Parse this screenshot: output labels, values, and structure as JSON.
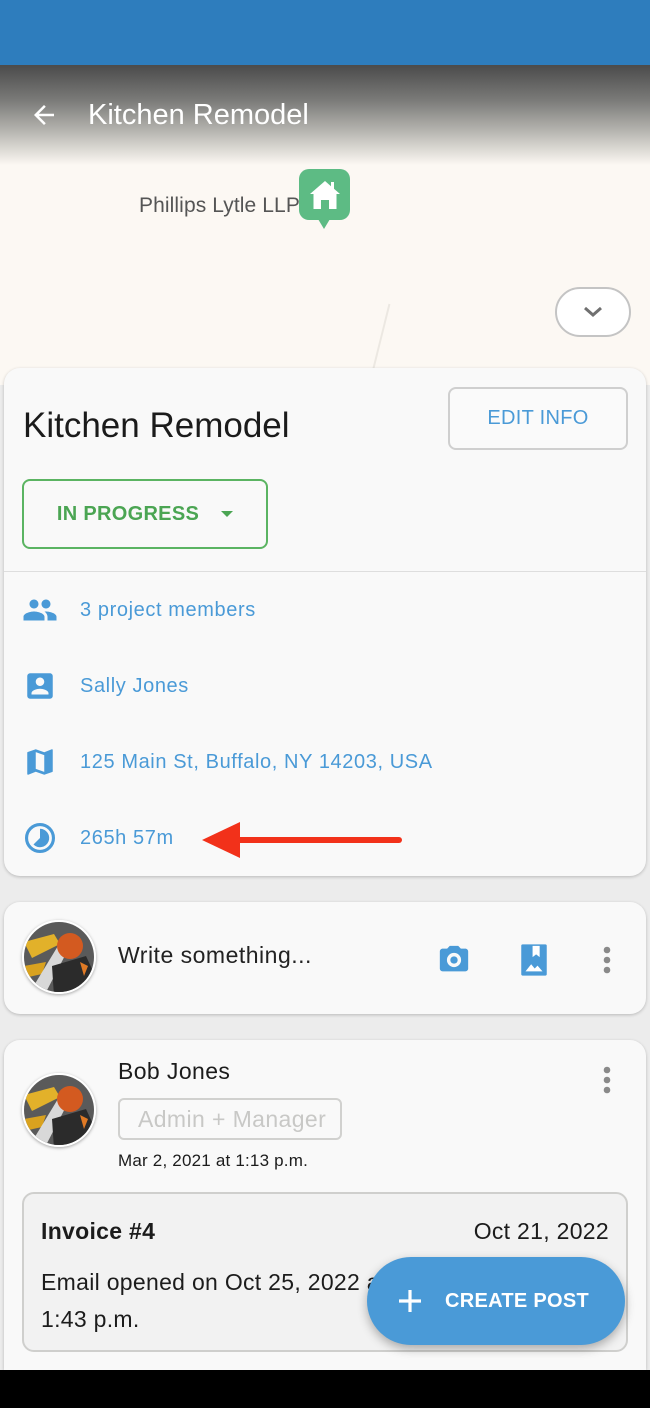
{
  "colors": {
    "status_bar": "#2e7dbd",
    "accent_blue": "#4a9ad7",
    "status_green": "#4ba553",
    "map_pin_green": "#5dbb84",
    "annotation_red": "#f2311a"
  },
  "app_bar": {
    "title": "Kitchen Remodel",
    "back_icon": "arrow-back-icon"
  },
  "map": {
    "place_label": "Phillips Lytle LLP",
    "pin_icon": "home-icon",
    "collapse_icon": "chevron-down-icon"
  },
  "project": {
    "title": "Kitchen Remodel",
    "edit_label": "EDIT INFO",
    "status": "IN PROGRESS",
    "info": [
      {
        "icon": "people-icon",
        "text": "3 project members"
      },
      {
        "icon": "contact-icon",
        "text": "Sally Jones"
      },
      {
        "icon": "map-icon",
        "text": "125 Main St, Buffalo, NY 14203, USA"
      },
      {
        "icon": "clock-icon",
        "text": "265h 57m"
      }
    ]
  },
  "composer": {
    "placeholder": "Write something...",
    "camera_icon": "camera-icon",
    "gallery_icon": "photo-album-icon",
    "more_icon": "more-vert-icon"
  },
  "post": {
    "author": "Bob Jones",
    "role": "Admin + Manager",
    "timestamp": "Mar 2, 2021 at 1:13 p.m.",
    "invoice": {
      "title": "Invoice #4",
      "date": "Oct 21, 2022",
      "description": "Email opened on Oct 25, 2022 at 1:43 p.m."
    }
  },
  "fab": {
    "label": "CREATE POST",
    "icon": "plus-icon"
  }
}
